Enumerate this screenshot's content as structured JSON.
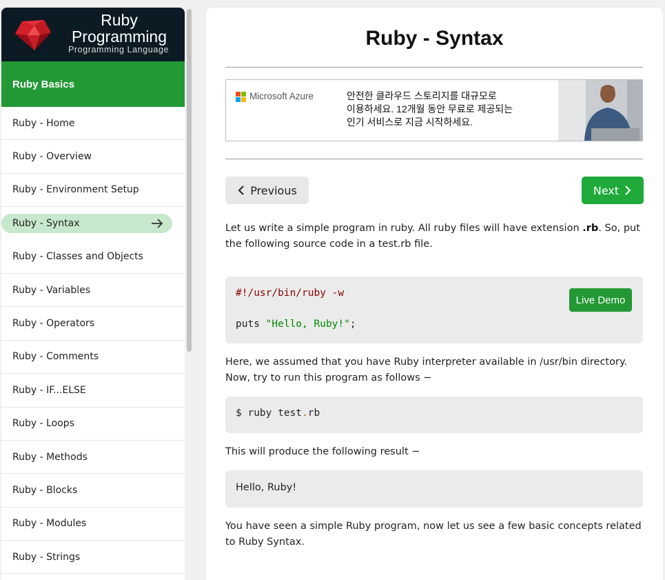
{
  "brand": {
    "title_line1": "Ruby",
    "title_line2": "Programming",
    "subtitle": "Programming Language",
    "logo_icon": "ruby-gem-icon",
    "bg_color": "#0b1a23"
  },
  "sidebar": {
    "section_title": "Ruby Basics",
    "section_color": "#229935",
    "active_index": 3,
    "items": [
      {
        "label": "Ruby - Home"
      },
      {
        "label": "Ruby - Overview"
      },
      {
        "label": "Ruby - Environment Setup"
      },
      {
        "label": "Ruby - Syntax",
        "active": true,
        "icon": "arrow-right-icon"
      },
      {
        "label": "Ruby - Classes and Objects"
      },
      {
        "label": "Ruby - Variables"
      },
      {
        "label": "Ruby - Operators"
      },
      {
        "label": "Ruby - Comments"
      },
      {
        "label": "Ruby - IF...ELSE"
      },
      {
        "label": "Ruby - Loops"
      },
      {
        "label": "Ruby - Methods"
      },
      {
        "label": "Ruby - Blocks"
      },
      {
        "label": "Ruby - Modules"
      },
      {
        "label": "Ruby - Strings"
      }
    ]
  },
  "main": {
    "title": "Ruby - Syntax",
    "ad": {
      "brand_name": "Microsoft Azure",
      "lines": [
        "안전한 클라우드 스토리지를 대규모로",
        "이용하세요. 12개월 동안 무료로 제공되는",
        "인기 서비스로 지금 시작하세요."
      ]
    },
    "nav": {
      "prev_label": "Previous",
      "prev_icon": "chevron-left-icon",
      "next_label": "Next",
      "next_icon": "chevron-right-icon",
      "next_color": "#1faa3a"
    },
    "para1_pre": "Let us write a simple program in ruby. All ruby files will have extension ",
    "para1_bold": ".rb",
    "para1_post": ". So, put the following source code in a test.rb file.",
    "code1": {
      "line1": "#!/usr/bin/ruby -w",
      "line2_kw": "puts ",
      "line2_str": "\"Hello, Ruby!\"",
      "line2_end": ";",
      "live_demo_label": "Live Demo"
    },
    "para2": "Here, we assumed that you have Ruby interpreter available in /usr/bin directory. Now, try to run this program as follows −",
    "code2": {
      "pre": "$ ruby test",
      "dot": ".",
      "post": "rb"
    },
    "para3": "This will produce the following result −",
    "output": "Hello, Ruby!",
    "para4": "You have seen a simple Ruby program, now let us see a few basic concepts related to Ruby Syntax."
  }
}
